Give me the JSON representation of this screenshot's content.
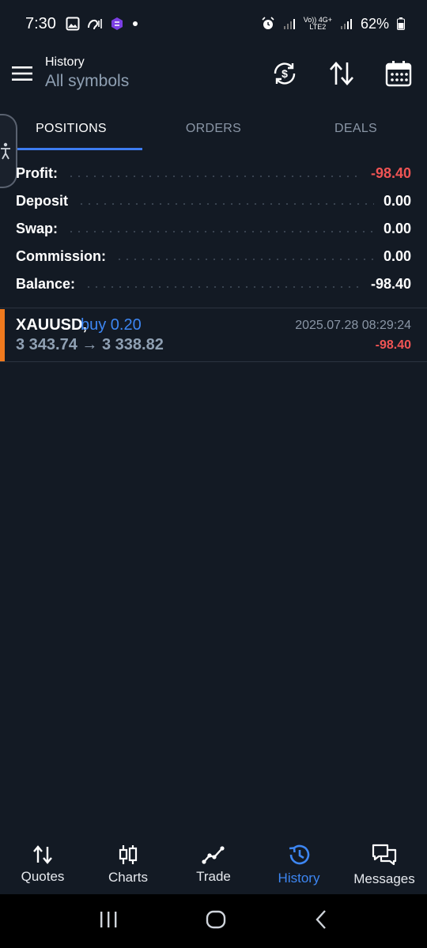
{
  "status_bar": {
    "time": "7:30",
    "network_label_top": "Vo)) 4G+",
    "network_label_bottom": "LTE2",
    "battery": "62%"
  },
  "header": {
    "title": "History",
    "subtitle": "All symbols",
    "icons": [
      "menu-icon",
      "currency-sync-icon",
      "sort-icon",
      "calendar-icon"
    ]
  },
  "tabs": [
    {
      "label": "POSITIONS",
      "active": true
    },
    {
      "label": "ORDERS",
      "active": false
    },
    {
      "label": "DEALS",
      "active": false
    }
  ],
  "summary": [
    {
      "label": "Profit:",
      "value": "-98.40",
      "negative": true
    },
    {
      "label": "Deposit",
      "value": "0.00",
      "negative": false
    },
    {
      "label": "Swap:",
      "value": "0.00",
      "negative": false
    },
    {
      "label": "Commission:",
      "value": "0.00",
      "negative": false
    },
    {
      "label": "Balance:",
      "value": "-98.40",
      "negative": false
    }
  ],
  "positions": [
    {
      "symbol": "XAUUSD,",
      "type": "buy 0.20",
      "prices": "3 343.74 → 3 338.82",
      "time": "2025.07.28 08:29:24",
      "profit": "-98.40"
    }
  ],
  "bottom_nav": [
    {
      "label": "Quotes",
      "icon": "quotes-arrows-icon",
      "active": false
    },
    {
      "label": "Charts",
      "icon": "candlestick-icon",
      "active": false
    },
    {
      "label": "Trade",
      "icon": "trend-line-icon",
      "active": false
    },
    {
      "label": "History",
      "icon": "history-clock-icon",
      "active": true
    },
    {
      "label": "Messages",
      "icon": "chat-bubbles-icon",
      "active": false
    }
  ],
  "colors": {
    "background": "#131a24",
    "accent_blue": "#3d86f2",
    "negative_red": "#f05454",
    "position_accent": "#f07a1e"
  }
}
